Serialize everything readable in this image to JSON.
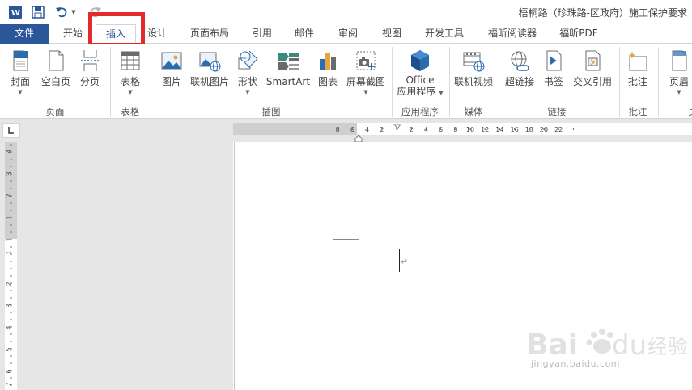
{
  "window": {
    "document_title": "梧桐路（珍珠路-区政府）施工保护要求"
  },
  "tabs": [
    {
      "id": "file",
      "label": "文件"
    },
    {
      "id": "home",
      "label": "开始"
    },
    {
      "id": "insert",
      "label": "插入",
      "active": true
    },
    {
      "id": "design",
      "label": "设计"
    },
    {
      "id": "layout",
      "label": "页面布局"
    },
    {
      "id": "references",
      "label": "引用"
    },
    {
      "id": "mailings",
      "label": "邮件"
    },
    {
      "id": "review",
      "label": "审阅"
    },
    {
      "id": "view",
      "label": "视图"
    },
    {
      "id": "developer",
      "label": "开发工具"
    },
    {
      "id": "foxit-reader",
      "label": "福昕阅读器"
    },
    {
      "id": "foxit-pdf",
      "label": "福昕PDF"
    }
  ],
  "ribbon": {
    "groups": [
      {
        "label": "页面",
        "buttons": [
          {
            "label": "封面",
            "icon": "cover-page-icon",
            "dropdown": true
          },
          {
            "label": "空白页",
            "icon": "blank-page-icon"
          },
          {
            "label": "分页",
            "icon": "page-break-icon"
          }
        ]
      },
      {
        "label": "表格",
        "buttons": [
          {
            "label": "表格",
            "icon": "table-icon",
            "dropdown": true
          }
        ]
      },
      {
        "label": "插图",
        "buttons": [
          {
            "label": "图片",
            "icon": "picture-icon"
          },
          {
            "label": "联机图片",
            "icon": "online-picture-icon"
          },
          {
            "label": "形状",
            "icon": "shapes-icon",
            "dropdown": true
          },
          {
            "label": "SmartArt",
            "icon": "smartart-icon"
          },
          {
            "label": "图表",
            "icon": "chart-icon"
          },
          {
            "label": "屏幕截图",
            "icon": "screenshot-icon",
            "dropdown": true
          }
        ]
      },
      {
        "label": "应用程序",
        "buttons": [
          {
            "label": "Office",
            "label2": "应用程序",
            "icon": "office-apps-icon",
            "dropdown": true
          }
        ]
      },
      {
        "label": "媒体",
        "buttons": [
          {
            "label": "联机视频",
            "icon": "online-video-icon"
          }
        ]
      },
      {
        "label": "链接",
        "buttons": [
          {
            "label": "超链接",
            "icon": "hyperlink-icon"
          },
          {
            "label": "书签",
            "icon": "bookmark-icon"
          },
          {
            "label": "交叉引用",
            "icon": "cross-reference-icon"
          }
        ]
      },
      {
        "label": "批注",
        "buttons": [
          {
            "label": "批注",
            "icon": "comment-icon"
          }
        ]
      },
      {
        "label": "页",
        "buttons": [
          {
            "label": "页眉",
            "icon": "header-icon",
            "dropdown": true
          }
        ]
      }
    ]
  },
  "ruler": {
    "h_ticks": [
      "8",
      "6",
      "4",
      "2",
      "2",
      "4",
      "6",
      "8",
      "10",
      "12",
      "14",
      "16",
      "18",
      "20",
      "22"
    ],
    "v_ticks": [
      "4",
      "3",
      "2",
      "1",
      "1",
      "1",
      "2",
      "3",
      "4",
      "5",
      "6",
      "7",
      "8"
    ]
  },
  "colors": {
    "file_tab": "#2b579a",
    "highlight": "#e32a2a",
    "accent": "#2b579a"
  },
  "watermark": {
    "brand": "Bai经验",
    "url": "jingyan.baidu.com"
  }
}
